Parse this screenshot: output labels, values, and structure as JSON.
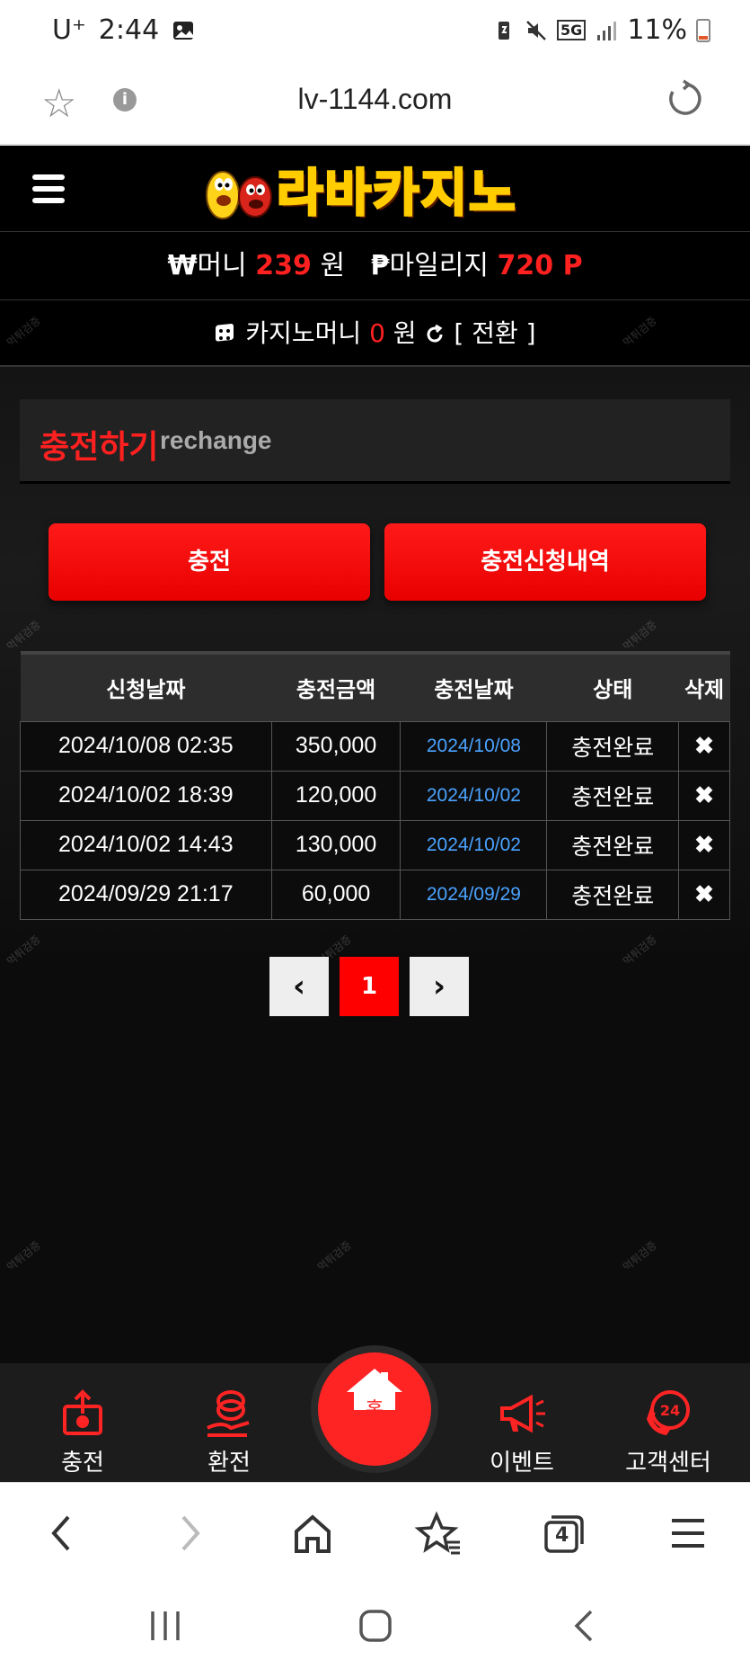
{
  "status_bar": {
    "carrier": "U⁺",
    "time": "2:44",
    "network": "5G",
    "battery": "11%"
  },
  "browser": {
    "url": "lv-1144.com",
    "tab_count": "4"
  },
  "header": {
    "logo_text": "라바카지노"
  },
  "wallet": {
    "money_symbol": "₩",
    "money_label": "머니",
    "money_value": "239",
    "money_unit": "원",
    "mileage_symbol": "₱",
    "mileage_label": "마일리지",
    "mileage_value": "720 P"
  },
  "casino": {
    "label": "카지노머니",
    "value": "0",
    "unit": "원",
    "convert_label": "[ 전환 ]"
  },
  "page_title": {
    "ko": "충전하기",
    "en": "rechange"
  },
  "buttons": {
    "charge": "충전",
    "history": "충전신청내역"
  },
  "table": {
    "headers": [
      "신청날짜",
      "충전금액",
      "충전날짜",
      "상태",
      "삭제"
    ],
    "rows": [
      {
        "request_date": "2024/10/08 02:35",
        "amount": "350,000",
        "charge_date": "2024/10/08",
        "status": "충전완료",
        "delete": "✖"
      },
      {
        "request_date": "2024/10/02 18:39",
        "amount": "120,000",
        "charge_date": "2024/10/02",
        "status": "충전완료",
        "delete": "✖"
      },
      {
        "request_date": "2024/10/02 14:43",
        "amount": "130,000",
        "charge_date": "2024/10/02",
        "status": "충전완료",
        "delete": "✖"
      },
      {
        "request_date": "2024/09/29 21:17",
        "amount": "60,000",
        "charge_date": "2024/09/29",
        "status": "충전완료",
        "delete": "✖"
      }
    ]
  },
  "pagination": {
    "prev": "‹",
    "current": "1",
    "next": "›"
  },
  "bottom_nav": {
    "charge": "충전",
    "exchange": "환전",
    "home": "홈",
    "event": "이벤트",
    "support": "고객센터",
    "support_badge": "24"
  },
  "colors": {
    "accent": "#ff2020",
    "link_blue": "#4aa3ff",
    "nav_bg": "#1c1c1c"
  }
}
